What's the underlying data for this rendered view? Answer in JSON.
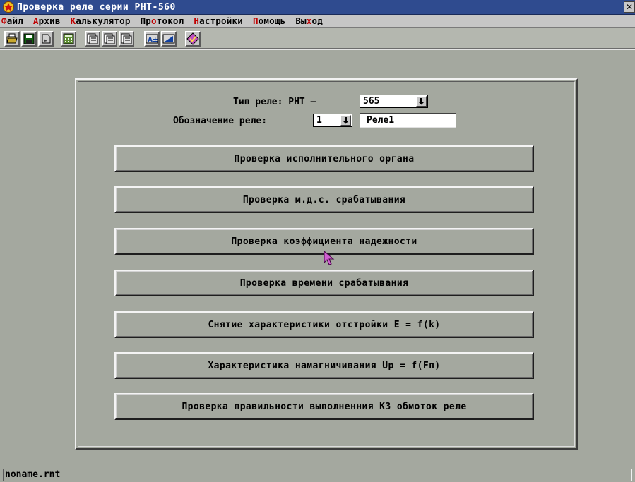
{
  "window": {
    "title": "Проверка реле серии РНТ-560",
    "close_glyph": "✕",
    "accent_color": "#2f4b8f",
    "background_color": "#a4a89f"
  },
  "menu": {
    "items": [
      {
        "hotkey": "Ф",
        "rest": "айл",
        "prefix": ""
      },
      {
        "hotkey": "А",
        "rest": "рхив",
        "prefix": ""
      },
      {
        "hotkey": "К",
        "rest": "алькулятор",
        "prefix": ""
      },
      {
        "hotkey": "о",
        "rest": "токол",
        "prefix": "Пр"
      },
      {
        "hotkey": "Н",
        "rest": "астройки",
        "prefix": ""
      },
      {
        "hotkey": "П",
        "rest": "омощь",
        "prefix": ""
      },
      {
        "hotkey": "х",
        "rest": "од",
        "prefix": "Вы"
      }
    ],
    "hotkey_color": "#c00000"
  },
  "toolbar": {
    "icons": [
      "open-file-icon",
      "save-disk-icon",
      "export-icon",
      "calculator-icon",
      "protocol-print-icon",
      "protocol-print-2-icon",
      "protocol-print-3-icon",
      "settings-font-icon",
      "settings-chart-icon",
      "help-book-icon"
    ]
  },
  "relay": {
    "type_label": "Тип реле: РНТ –",
    "type_value": "565",
    "designation_label": "Обозначение реле:",
    "designation_value": "1",
    "name_value": "Реле1"
  },
  "buttons": [
    {
      "label": "Проверка исполнительного органа"
    },
    {
      "label": "Проверка м.д.с. срабатывания"
    },
    {
      "label": "Проверка коэффициента надежности"
    },
    {
      "label": "Проверка времени срабатывания"
    },
    {
      "label": "Снятие характеристики отстройки E = f(k)"
    },
    {
      "label": "Характеристика намагничивания Up = f(Fп)"
    },
    {
      "label": "Проверка правильности выполненния КЗ обмоток реле"
    }
  ],
  "status": {
    "file_name": "noname.rnt"
  }
}
